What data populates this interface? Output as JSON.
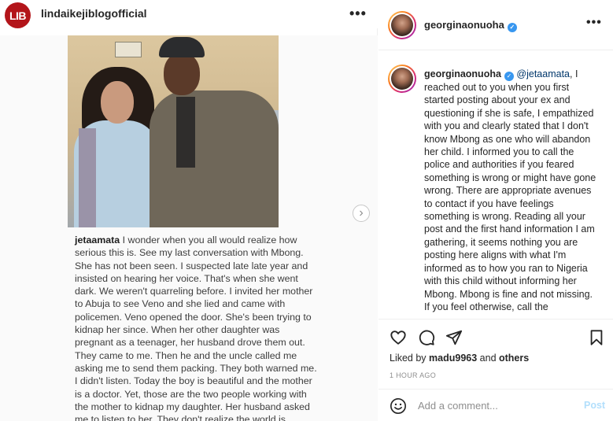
{
  "left_post": {
    "logo_text": "LIB",
    "username": "lindaikejiblogofficial",
    "more_label": "•••",
    "carousel_next": "›",
    "blurry_meta": " ···",
    "caption_user": "jetaamata",
    "caption_body": " I wonder when you all would realize how serious this is. See my last conversation  with Mbong. She has not been seen. I suspected late late year and insisted on hearing her voice. That's when she went dark. We weren't quarreling before. I invited her mother to Abuja to see Veno and she lied and came with policemen. Veno opened the door. She's been trying to kidnap her since. When her other daughter was pregnant as a teenager, her husband drove them out. They came to me. Then he and the uncle called me asking me to send them packing. They both warned me. I didn't listen. Today the boy is beautiful and the mother is a doctor. Yet, those are the two people working with the mother to kidnap my daughter. Her husband asked me to listen to her. They don't realize the world is watching. When Veno gets pregnant"
  },
  "right_panel": {
    "header_username": "georginaonuoha",
    "more_label": "•••",
    "verified_glyph": "✓",
    "comment_user": "georginaonuoha",
    "comment_mention": "@jetaamata",
    "comment_body": ", I reached out to you when you first started posting about your ex and questioning if she is safe, I empathized with you and clearly stated that I don't know Mbong as one who will abandon her child. I informed you to call the police and authorities if you feared something is wrong or might have gone wrong. There are appropriate avenues to contact if you have feelings something is wrong. Reading all your post and the first hand information I am gathering, it seems nothing you are posting here aligns with what I'm informed as to how you ran to Nigeria with this child without informing her Mbong. Mbong is fine and not missing. If you feel otherwise, call the",
    "likes_prefix": "Liked by ",
    "likes_user": "madu9963",
    "likes_and": " and ",
    "likes_others": "others",
    "time_ago": "1 HOUR AGO",
    "comment_placeholder": "Add a comment...",
    "post_label": "Post"
  },
  "icons": {
    "like": "heart-icon",
    "comment": "comment-bubble-icon",
    "share": "paper-plane-icon",
    "save": "bookmark-icon",
    "emoji": "smiley-icon"
  },
  "colors": {
    "logo_red": "#b3151a",
    "verified_blue": "#3897f0",
    "post_button": "#b2dffc",
    "mention": "#00376b"
  }
}
